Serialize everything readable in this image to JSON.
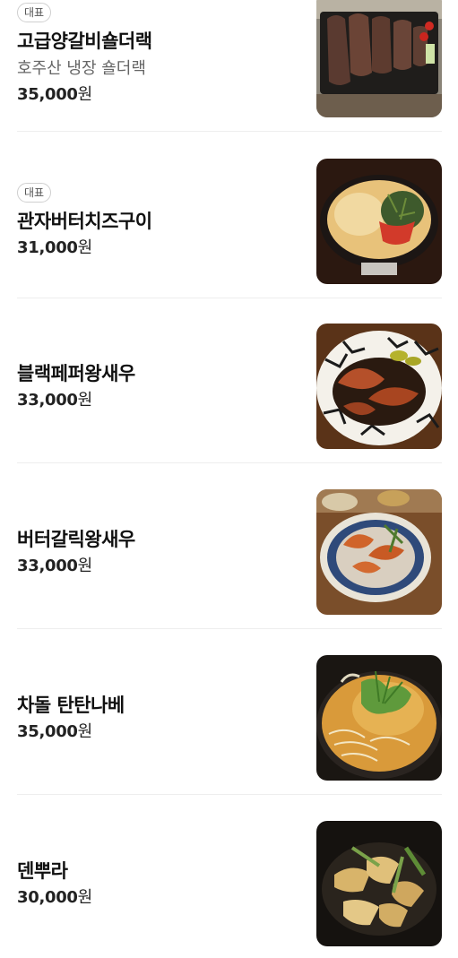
{
  "menu": {
    "items": [
      {
        "badge": "대표",
        "name": "고급양갈비숄더랙",
        "description": "호주산 냉장 숄더랙",
        "price": "35,000",
        "currency": "원",
        "image": "lamb-shoulder-rack-photo"
      },
      {
        "badge": "대표",
        "name": "관자버터치즈구이",
        "description": "",
        "price": "31,000",
        "currency": "원",
        "image": "scallop-butter-cheese-photo"
      },
      {
        "badge": "",
        "name": "블랙페퍼왕새우",
        "description": "",
        "price": "33,000",
        "currency": "원",
        "image": "black-pepper-prawn-photo"
      },
      {
        "badge": "",
        "name": "버터갈릭왕새우",
        "description": "",
        "price": "33,000",
        "currency": "원",
        "image": "butter-garlic-prawn-photo"
      },
      {
        "badge": "",
        "name": "차돌 탄탄나베",
        "description": "",
        "price": "35,000",
        "currency": "원",
        "image": "brisket-tantan-nabe-photo"
      },
      {
        "badge": "",
        "name": "덴뿌라",
        "description": "",
        "price": "30,000",
        "currency": "원",
        "image": "tempura-photo"
      }
    ]
  }
}
